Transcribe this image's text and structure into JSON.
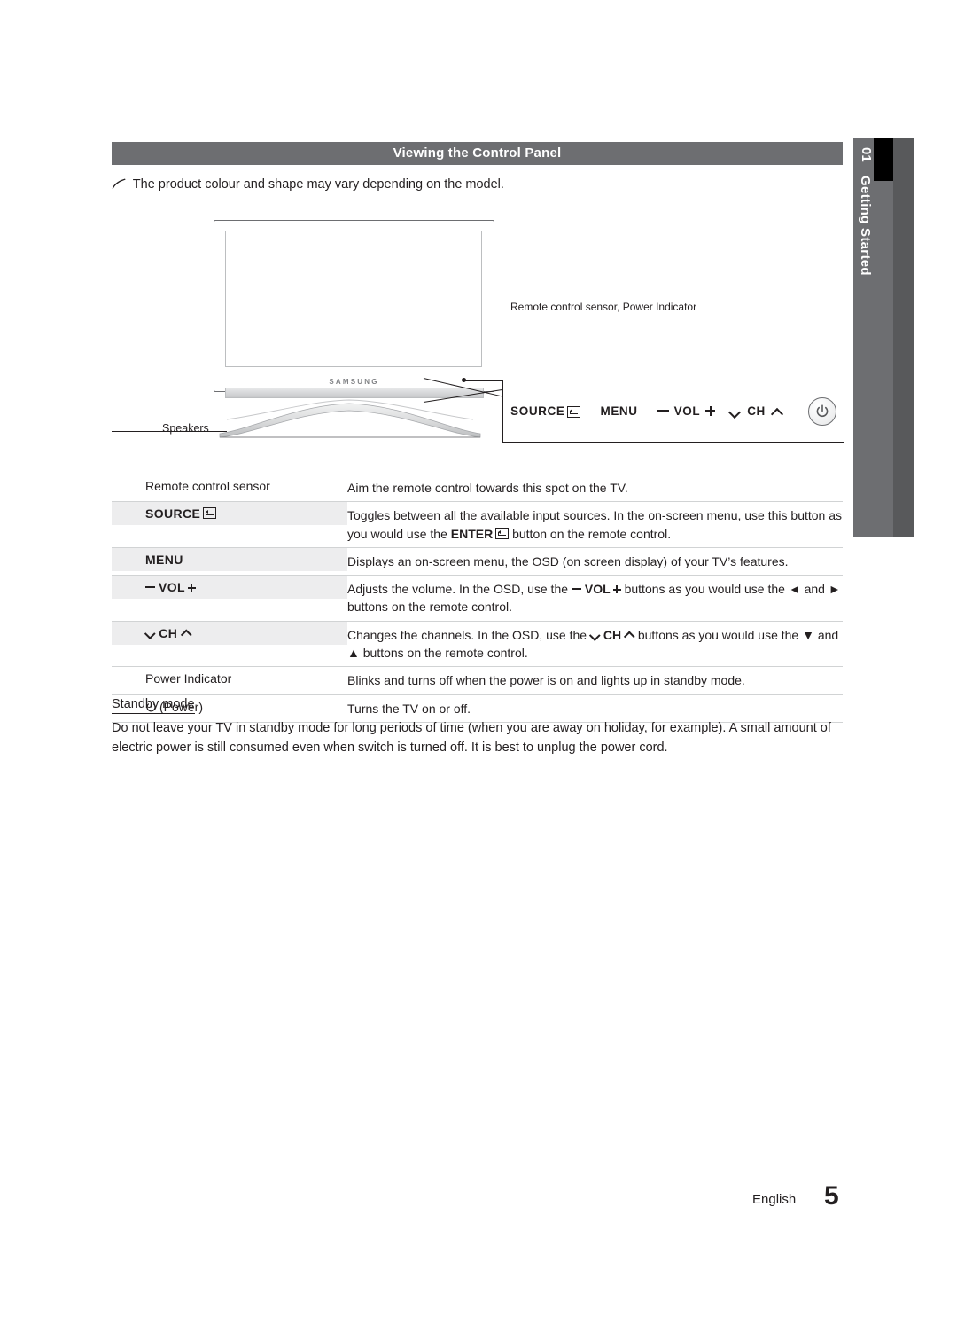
{
  "header": {
    "title": "Viewing the Control Panel"
  },
  "side_tab": {
    "number": "01",
    "label": "Getting Started"
  },
  "note": {
    "icon": "pencil-note-icon",
    "text": "The product colour and shape may vary depending on the model."
  },
  "diagram": {
    "brand": "SAMSUNG",
    "sensor_callout": "Remote control sensor, Power Indicator",
    "speakers_label": "Speakers",
    "panel_buttons": [
      {
        "label": "SOURCE",
        "icon": "enter-icon"
      },
      {
        "label": "MENU",
        "icon": ""
      },
      {
        "label": "VOL",
        "icon": "minus-plus-icon"
      },
      {
        "label": "CH",
        "icon": "chevron-down-up-icon"
      },
      {
        "label": "",
        "icon": "power-icon"
      }
    ]
  },
  "table": {
    "rows": [
      {
        "name": "Remote control sensor",
        "bold": false,
        "shaded": false,
        "desc_html": "Aim the remote control towards this spot on the TV."
      },
      {
        "name": "SOURCE",
        "bold": true,
        "shaded": true,
        "icon": "enter-icon",
        "desc_html": "Toggles between all the available input sources. In the on-screen menu, use this button as you would use the <b>ENTER</b><span class=\"enter-inline\"></span> button on the remote control."
      },
      {
        "name": "MENU",
        "bold": true,
        "shaded": true,
        "desc_html": "Displays an on-screen menu, the OSD (on screen display) of your TV's features."
      },
      {
        "name": "VOL",
        "bold": true,
        "shaded": true,
        "icon": "minus-plus-icon",
        "desc_html": "Adjusts the volume. In the OSD, use the <b>VOL</b> buttons as you would use the &#9668; and &#9658; buttons on the remote control."
      },
      {
        "name": "CH",
        "bold": true,
        "shaded": true,
        "icon": "chevron-down-up-icon",
        "desc_html": "Changes the channels. In the OSD, use the <b>CH</b> buttons as you would use the &#9660; and &#9650; buttons on the remote control."
      },
      {
        "name": "Power Indicator",
        "bold": false,
        "shaded": false,
        "desc_html": "Blinks and turns off when the power is on and lights up in standby mode."
      },
      {
        "name": "(Power)",
        "bold": false,
        "shaded": false,
        "icon": "power-icon",
        "desc_html": "Turns the TV on or off."
      }
    ]
  },
  "standby": {
    "heading": "Standby mode",
    "body": "Do not leave your TV in standby mode for long periods of time (when you are away on holiday, for example). A small amount of electric power is still consumed even when switch is turned off. It is best to unplug the power cord."
  },
  "footer": {
    "language": "English",
    "page": "5"
  },
  "colors": {
    "header_bar": "#6d6e71",
    "tab_dark": "#58595b",
    "row_shade": "#ededee",
    "text": "#231f20"
  }
}
